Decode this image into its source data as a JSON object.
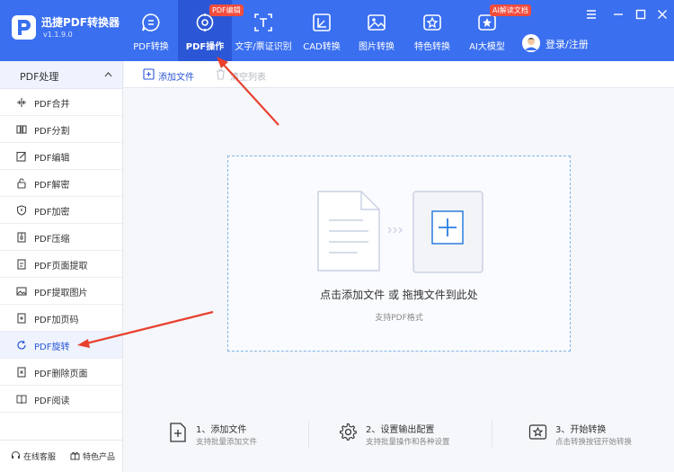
{
  "app": {
    "name": "迅捷PDF转换器",
    "version": "v1.1.9.0"
  },
  "nav": {
    "tabs": [
      {
        "label": "PDF转换",
        "icon": "chat-bubble-icon"
      },
      {
        "label": "PDF操作",
        "icon": "pdf-gear-icon",
        "badge": "PDF编辑",
        "active": true
      },
      {
        "label": "文字/票证识别",
        "icon": "scan-text-icon"
      },
      {
        "label": "CAD转换",
        "icon": "cad-icon"
      },
      {
        "label": "图片转换",
        "icon": "image-icon"
      },
      {
        "label": "特色转换",
        "icon": "star-swap-icon"
      },
      {
        "label": "AI大模型",
        "icon": "ai-icon",
        "badge": "AI解读文档"
      }
    ],
    "login_label": "登录/注册"
  },
  "sidebar": {
    "header": "PDF处理",
    "items": [
      {
        "label": "PDF合并",
        "icon": "merge-icon"
      },
      {
        "label": "PDF分割",
        "icon": "split-icon"
      },
      {
        "label": "PDF编辑",
        "icon": "edit-icon"
      },
      {
        "label": "PDF解密",
        "icon": "unlock-icon"
      },
      {
        "label": "PDF加密",
        "icon": "shield-icon"
      },
      {
        "label": "PDF压缩",
        "icon": "compress-icon"
      },
      {
        "label": "PDF页面提取",
        "icon": "page-extract-icon"
      },
      {
        "label": "PDF提取图片",
        "icon": "image-extract-icon"
      },
      {
        "label": "PDF加页码",
        "icon": "page-number-icon"
      },
      {
        "label": "PDF旋转",
        "icon": "rotate-icon",
        "active": true
      },
      {
        "label": "PDF删除页面",
        "icon": "delete-page-icon"
      },
      {
        "label": "PDF阅读",
        "icon": "book-icon"
      }
    ],
    "footer": {
      "service": "在线客服",
      "products": "特色产品"
    }
  },
  "toolbar": {
    "add_file": "添加文件",
    "clear_list": "清空列表"
  },
  "dropzone": {
    "main": "点击添加文件 或 拖拽文件到此处",
    "sub": "支持PDF格式"
  },
  "steps": [
    {
      "title": "1、添加文件",
      "desc": "支持批量添加文件",
      "icon": "add-file-icon"
    },
    {
      "title": "2、设置输出配置",
      "desc": "支持批量操作和各种设置",
      "icon": "settings-gear-icon"
    },
    {
      "title": "3、开始转换",
      "desc": "点击转换按钮开始转换",
      "icon": "convert-icon"
    }
  ],
  "colors": {
    "brand": "#3a6ff0",
    "active_tab": "#2b57d6",
    "badge": "#f24c3d",
    "annotation_arrow": "#e8412f"
  }
}
